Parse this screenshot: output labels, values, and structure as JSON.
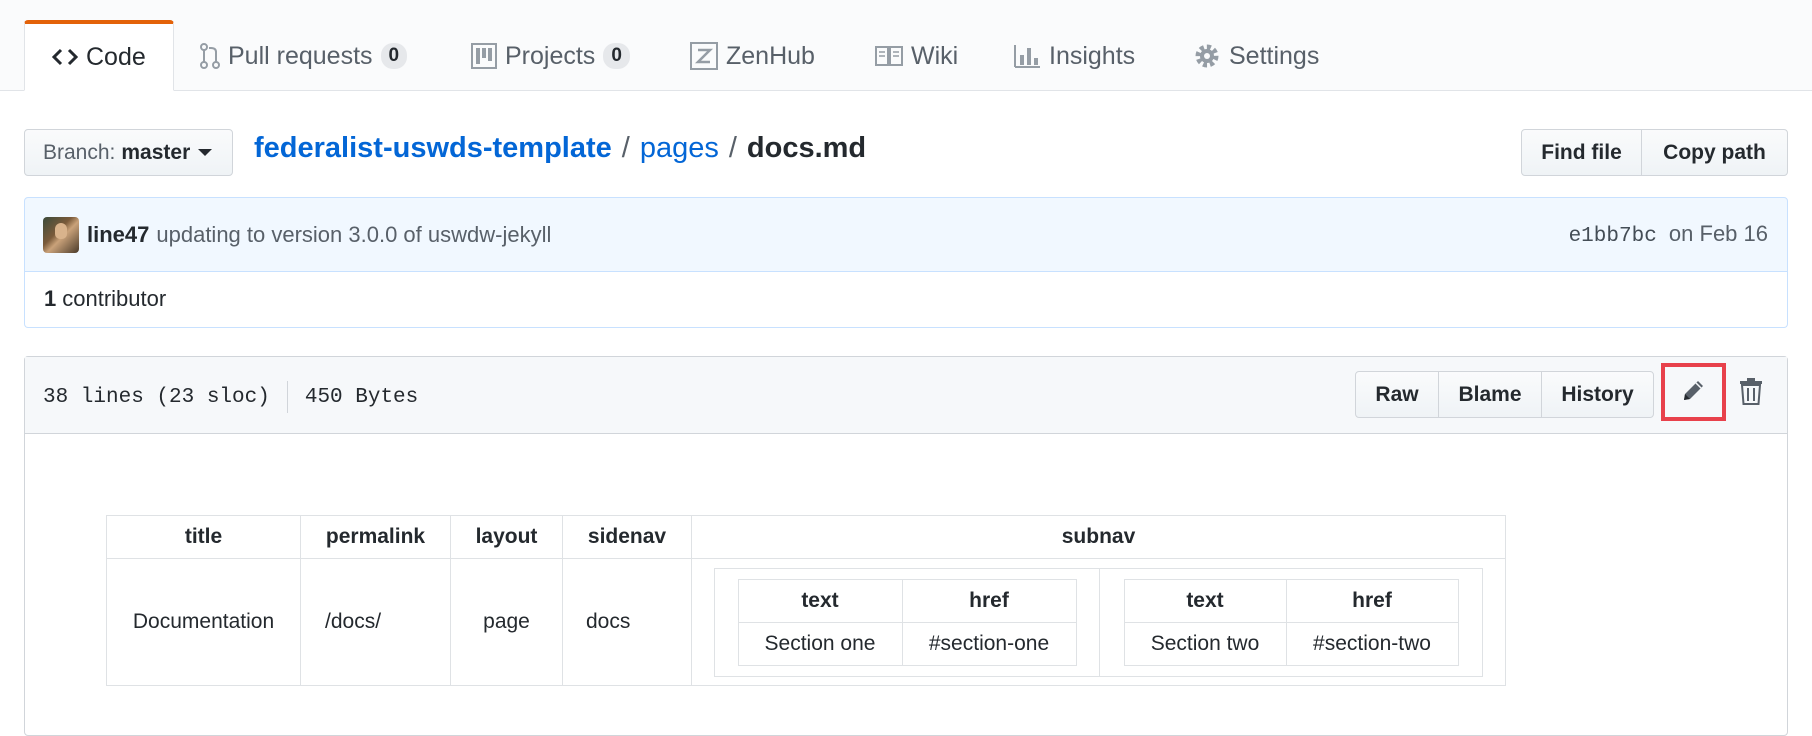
{
  "tabs": [
    {
      "label": "Code",
      "icon": "code-icon",
      "selected": true
    },
    {
      "label": "Pull requests",
      "icon": "git-pull-request-icon",
      "count": "0"
    },
    {
      "label": "Projects",
      "icon": "project-icon",
      "count": "0"
    },
    {
      "label": "ZenHub",
      "icon": "zenhub-icon"
    },
    {
      "label": "Wiki",
      "icon": "book-icon"
    },
    {
      "label": "Insights",
      "icon": "graph-icon"
    },
    {
      "label": "Settings",
      "icon": "gear-icon"
    }
  ],
  "branch": {
    "label": "Branch:",
    "value": "master"
  },
  "breadcrumb": {
    "repo": "federalist-uswds-template",
    "sep": "/",
    "dir": "pages",
    "file": "docs.md"
  },
  "file_nav": {
    "find_file": "Find file",
    "copy_path": "Copy path"
  },
  "commit": {
    "author": "line47",
    "message": "updating to version 3.0.0 of uswdw-jekyll",
    "sha": "e1bb7bc",
    "date": "on Feb 16"
  },
  "contributors": {
    "count": "1",
    "label": "contributor"
  },
  "file": {
    "lines": "38 lines (23 sloc)",
    "size": "450 Bytes",
    "raw": "Raw",
    "blame": "Blame",
    "history": "History",
    "edit_icon": "pencil-icon",
    "delete_icon": "trashcan-icon"
  },
  "front_matter": {
    "headers": [
      "title",
      "permalink",
      "layout",
      "sidenav",
      "subnav"
    ],
    "row": {
      "title": "Documentation",
      "permalink": "/docs/",
      "layout": "page",
      "sidenav": "docs"
    },
    "subnav": [
      {
        "headers": [
          "text",
          "href"
        ],
        "values": [
          "Section one",
          "#section-one"
        ]
      },
      {
        "headers": [
          "text",
          "href"
        ],
        "values": [
          "Section two",
          "#section-two"
        ]
      }
    ]
  }
}
